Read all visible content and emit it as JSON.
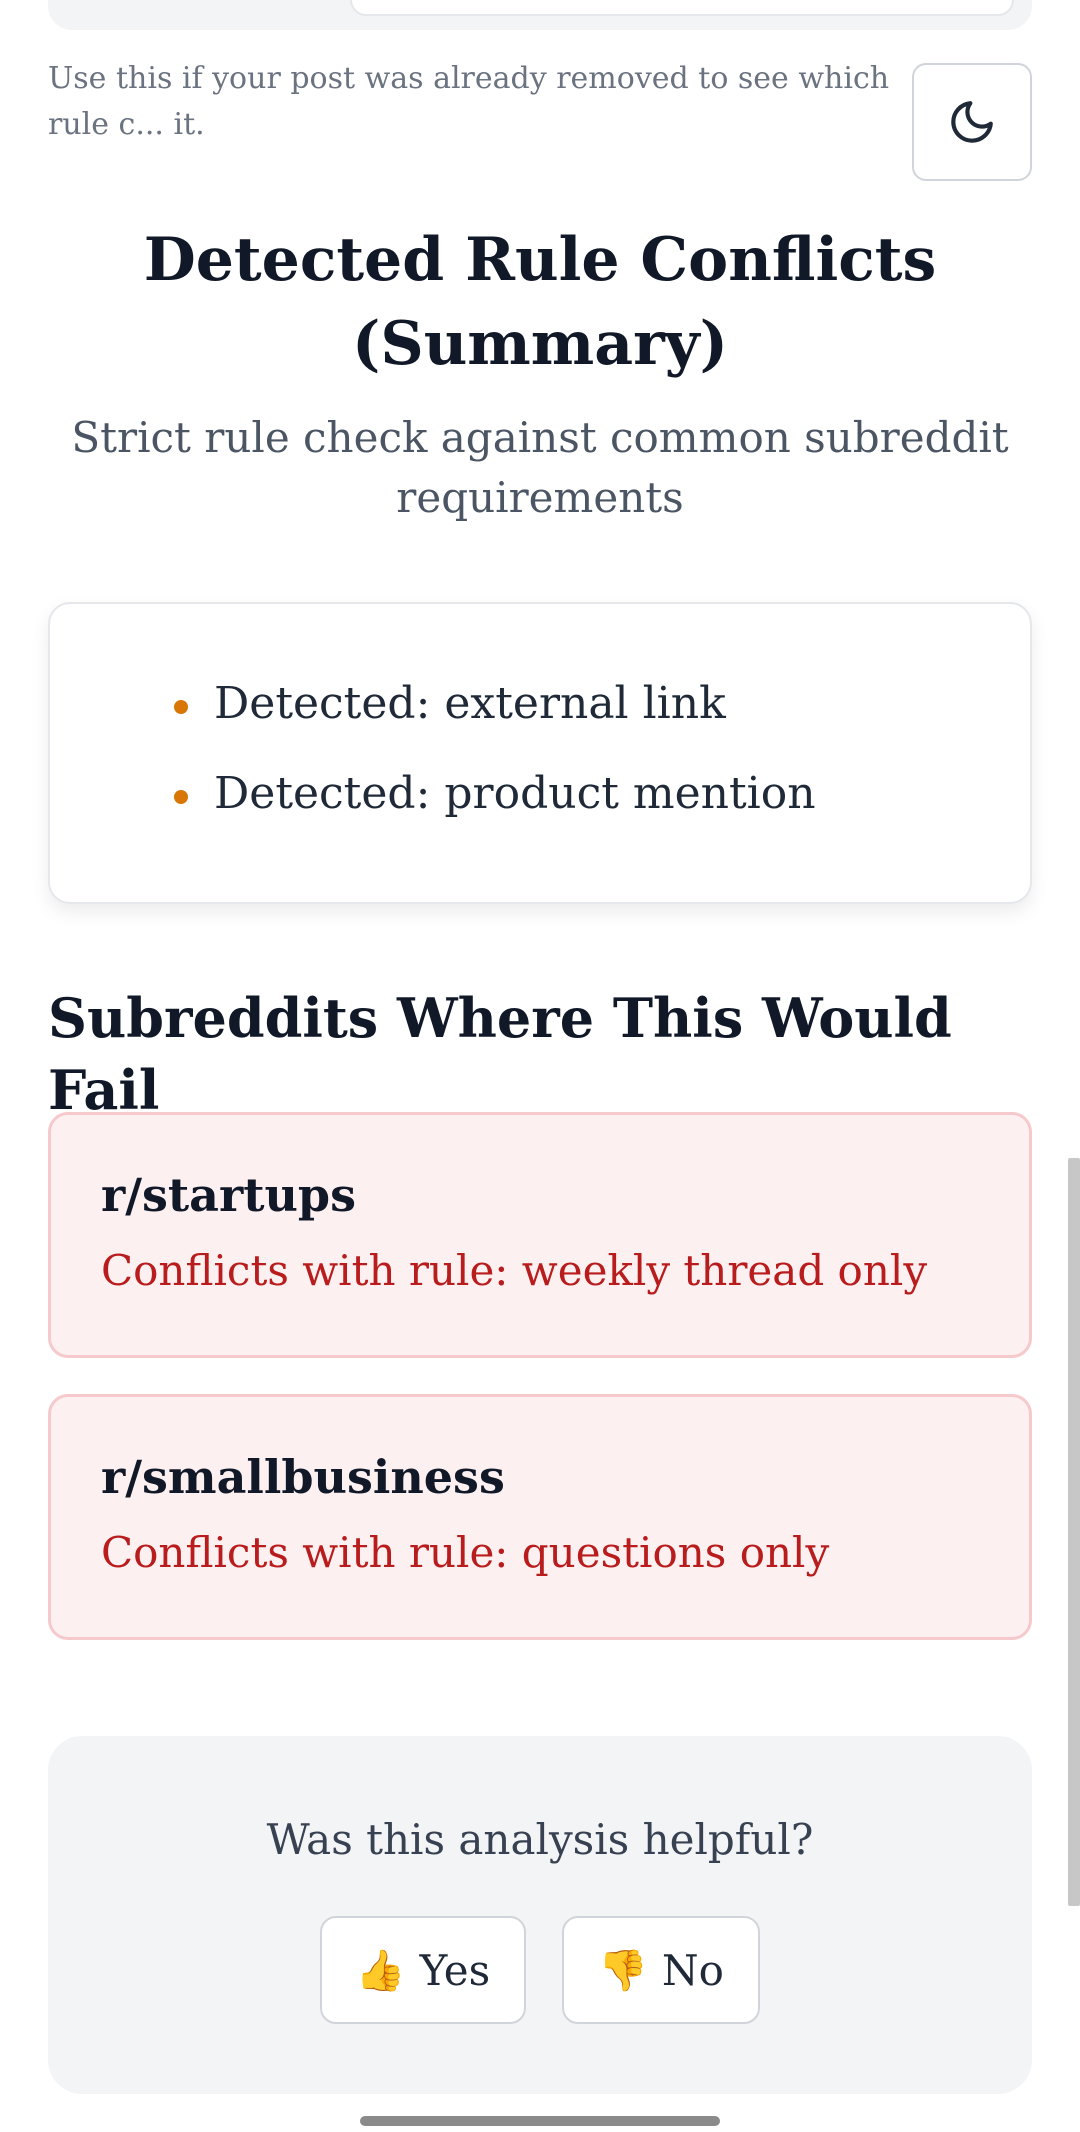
{
  "hint": {
    "text": "Use this if your post was already removed to see which rule c... it."
  },
  "theme_toggle": {
    "icon": "moon-icon"
  },
  "summary": {
    "title": "Detected Rule Conflicts (Summary)",
    "subtitle": "Strict rule check against common subreddit requirements"
  },
  "detections": [
    {
      "text": "Detected: external link"
    },
    {
      "text": "Detected: product mention"
    }
  ],
  "fail_section": {
    "heading": "Subreddits Where This Would Fail"
  },
  "conflicts": [
    {
      "name": "r/startups",
      "rule": "Conflicts with rule: weekly thread only"
    },
    {
      "name": "r/smallbusiness",
      "rule": "Conflicts with rule: questions only"
    }
  ],
  "feedback": {
    "question": "Was this analysis helpful?",
    "yes_label": "Yes",
    "no_label": "No",
    "yes_icon": "thumbs-up-icon",
    "no_icon": "thumbs-down-icon"
  },
  "colors": {
    "bullet": "#d97706",
    "conflict_bg": "#fdf0f1",
    "conflict_text": "#b91c1c"
  }
}
